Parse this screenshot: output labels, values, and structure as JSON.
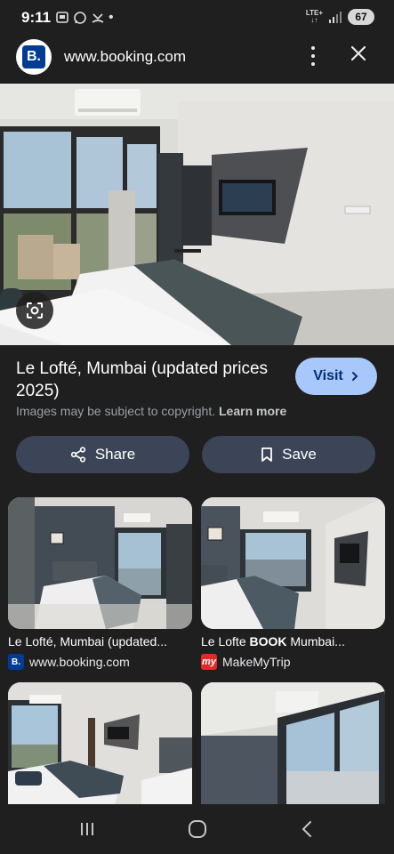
{
  "status_bar": {
    "time": "9:11",
    "dot": "•",
    "network": "LTE+",
    "battery": "67"
  },
  "header": {
    "logo_letter": "B.",
    "url": "www.booking.com"
  },
  "result": {
    "title": "Le Lofté, Mumbai (updated prices 2025)",
    "visit_label": "Visit",
    "copyright_prefix": "Images may be subject to copyright.",
    "learn_more": "Learn more"
  },
  "actions": {
    "share_label": "Share",
    "save_label": "Save"
  },
  "related": [
    {
      "title": "Le Lofté, Mumbai (updated...",
      "source": "www.booking.com",
      "favicon": "B."
    },
    {
      "title_prefix": "Le Lofte ",
      "title_bold": "BOOK",
      "title_suffix": " Mumbai...",
      "source": "MakeMyTrip",
      "favicon": "my"
    }
  ],
  "colors": {
    "accent": "#a8c7fa",
    "pill_bg": "#3c4557",
    "bg": "#1f1f1f",
    "booking_blue": "#003b95",
    "mmt_red": "#e02a2a"
  },
  "icons": [
    "messages-icon",
    "whatsapp-icon",
    "missed-call-icon",
    "signal-icon",
    "kebab-menu-icon",
    "close-icon",
    "google-lens-icon",
    "chevron-right-icon",
    "share-icon",
    "bookmark-icon",
    "recents-icon",
    "home-icon",
    "back-icon"
  ]
}
